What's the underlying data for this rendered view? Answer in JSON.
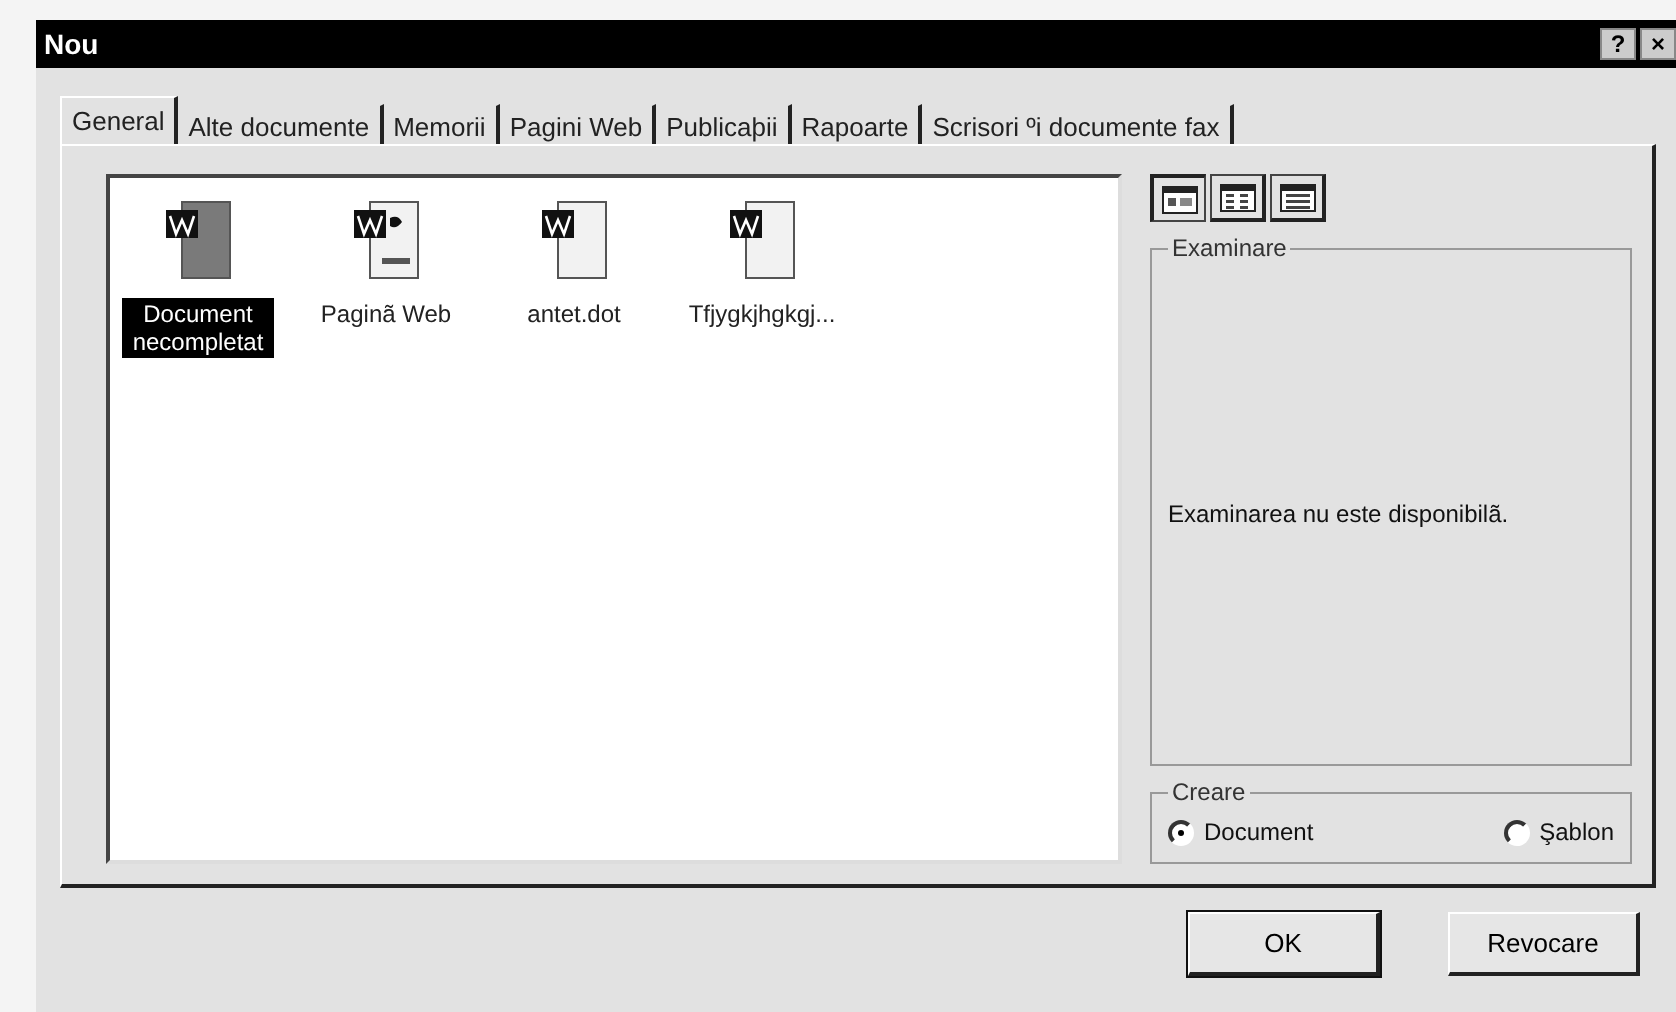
{
  "window": {
    "title": "Nou",
    "help_button": "?",
    "close_button": "×"
  },
  "tabs": [
    {
      "label": "General",
      "selected": true
    },
    {
      "label": "Alte documente",
      "selected": false
    },
    {
      "label": "Memorii",
      "selected": false
    },
    {
      "label": "Pagini Web",
      "selected": false
    },
    {
      "label": "Publicaþii",
      "selected": false
    },
    {
      "label": "Rapoarte",
      "selected": false
    },
    {
      "label": "Scrisori ºi documente fax",
      "selected": false
    }
  ],
  "templates": [
    {
      "label": "Document necompletat",
      "kind": "blank",
      "selected": true
    },
    {
      "label": "Paginã Web",
      "kind": "web",
      "selected": false
    },
    {
      "label": "antet.dot",
      "kind": "template",
      "selected": false
    },
    {
      "label": "Tfjygkjhgkgj...",
      "kind": "template",
      "selected": false
    }
  ],
  "view_buttons": [
    {
      "kind": "large",
      "selected": true
    },
    {
      "kind": "list",
      "selected": false
    },
    {
      "kind": "details",
      "selected": false
    }
  ],
  "preview": {
    "title": "Examinare",
    "message": "Examinarea nu este disponibilã."
  },
  "create": {
    "title": "Creare",
    "options": [
      {
        "label": "Document",
        "selected": true
      },
      {
        "label": "Şablon",
        "selected": false
      }
    ]
  },
  "buttons": [
    "OK",
    "Revocare"
  ]
}
